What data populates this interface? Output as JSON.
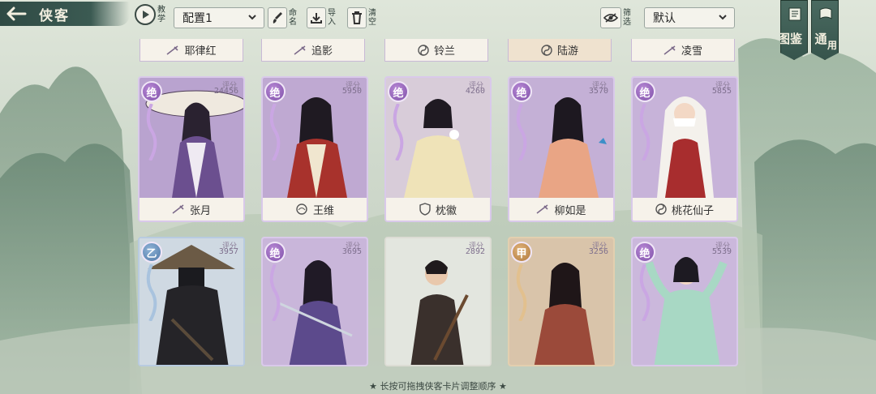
{
  "header": {
    "title": "侠客",
    "tutorial_label": "教学",
    "preset": "配置1",
    "rename_label": "命名",
    "import_label": "导入",
    "clear_label": "清空",
    "filter_label": "筛选",
    "sort": "默认",
    "codex_label": "图鉴",
    "codex_sub": "鉴",
    "general_label": "通",
    "general_sub": "用"
  },
  "top_row": [
    {
      "name": "耶律红",
      "icon": "sword-icon"
    },
    {
      "name": "追影",
      "icon": "sword-icon"
    },
    {
      "name": "铃兰",
      "icon": "taiji-icon"
    },
    {
      "name": "陆游",
      "icon": "taiji-icon"
    },
    {
      "name": "凌雪",
      "icon": "sword-icon"
    }
  ],
  "cards": [
    {
      "name": "张月",
      "grade": "绝",
      "score_label": "评分",
      "score": "24456",
      "icon": "sword-icon"
    },
    {
      "name": "王维",
      "grade": "绝",
      "score_label": "评分",
      "score": "5950",
      "icon": "lotus-icon"
    },
    {
      "name": "枕徽",
      "grade": "绝",
      "score_label": "评分",
      "score": "4260",
      "icon": "shield-icon"
    },
    {
      "name": "柳如是",
      "grade": "绝",
      "score_label": "评分",
      "score": "3570",
      "icon": "sword-icon"
    },
    {
      "name": "桃花仙子",
      "grade": "绝",
      "score_label": "评分",
      "score": "5855",
      "icon": "taiji-icon"
    },
    {
      "name": "",
      "grade": "乙",
      "score_label": "评分",
      "score": "3957",
      "icon": ""
    },
    {
      "name": "",
      "grade": "绝",
      "score_label": "评分",
      "score": "3695",
      "icon": ""
    },
    {
      "name": "",
      "grade": "",
      "score_label": "评分",
      "score": "2892",
      "icon": ""
    },
    {
      "name": "",
      "grade": "甲",
      "score_label": "评分",
      "score": "3256",
      "icon": ""
    },
    {
      "name": "",
      "grade": "绝",
      "score_label": "评分",
      "score": "5539",
      "icon": ""
    }
  ],
  "hint": "★ 长按可拖拽侠客卡片调整顺序 ★",
  "colors": {
    "accent": "#36544c",
    "card_border": "#d9c9ea",
    "grade_jue": "#7e4fa8",
    "grade_yi": "#4f78a8",
    "grade_jia": "#b07a3c"
  }
}
